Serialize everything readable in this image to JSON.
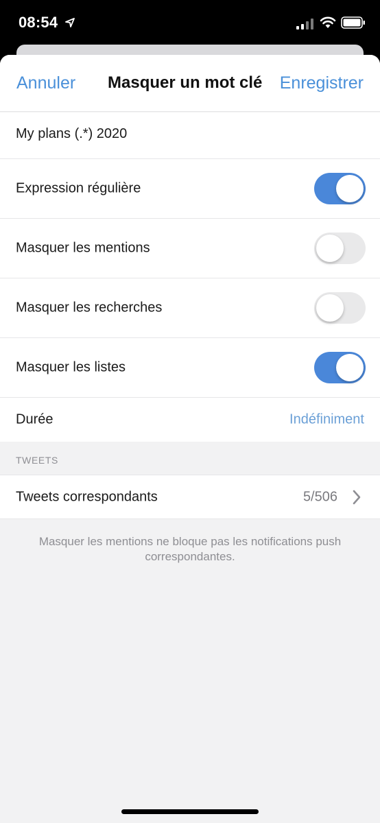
{
  "status_bar": {
    "time": "08:54",
    "icons": [
      "location-arrow-icon",
      "cellular-signal-icon",
      "wifi-icon",
      "battery-icon"
    ]
  },
  "nav": {
    "cancel_label": "Annuler",
    "title": "Masquer un mot clé",
    "save_label": "Enregistrer"
  },
  "keyword": {
    "value": "My plans (.*) 2020"
  },
  "options": [
    {
      "label": "Expression régulière",
      "state": "on"
    },
    {
      "label": "Masquer les mentions",
      "state": "off"
    },
    {
      "label": "Masquer les recherches",
      "state": "off"
    },
    {
      "label": "Masquer les listes",
      "state": "on"
    }
  ],
  "duration": {
    "label": "Durée",
    "value": "Indéfiniment"
  },
  "tweets_section": {
    "header": "TWEETS",
    "row_label": "Tweets correspondants",
    "count": "5/506"
  },
  "footer_note": "Masquer les mentions ne bloque pas les notifications push correspondantes.",
  "colors": {
    "accent": "#4a90d9",
    "toggle_on": "#4a87d9",
    "toggle_off": "#e9e9ea",
    "background": "#f2f2f3"
  }
}
